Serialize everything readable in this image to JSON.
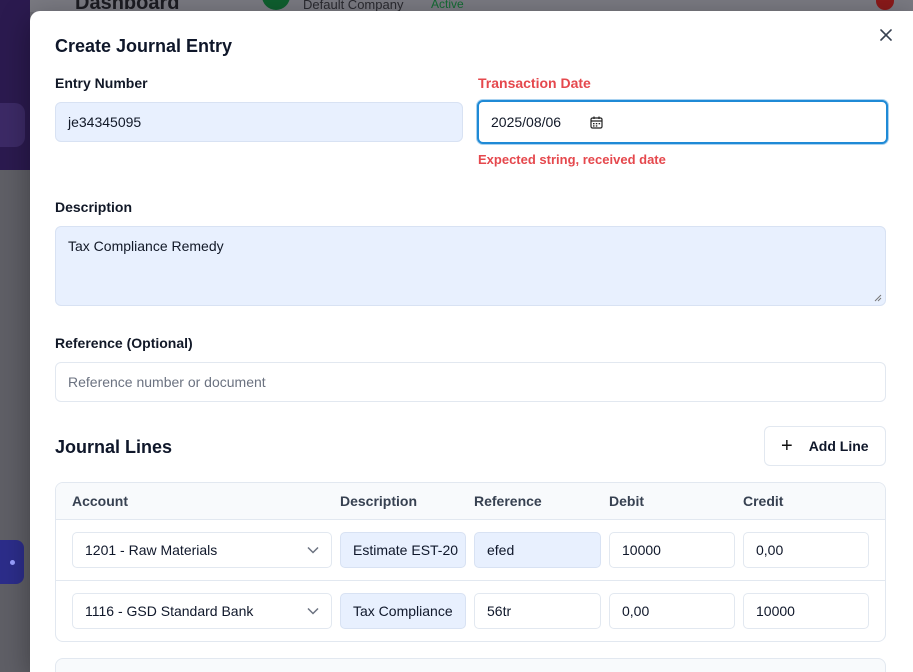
{
  "background": {
    "title": "Dashboard",
    "company": "Default Company",
    "company_status": "Active"
  },
  "modal": {
    "title": "Create Journal Entry",
    "entry_number": {
      "label": "Entry Number",
      "value": "je34345095"
    },
    "transaction_date": {
      "label": "Transaction Date",
      "value": "2025/08/06",
      "error": "Expected string, received date"
    },
    "description": {
      "label": "Description",
      "value": "Tax Compliance Remedy"
    },
    "reference": {
      "label": "Reference (Optional)",
      "placeholder": "Reference number or document"
    },
    "journal_lines": {
      "title": "Journal Lines",
      "add_line_label": "Add Line",
      "columns": [
        "Account",
        "Description",
        "Reference",
        "Debit",
        "Credit"
      ],
      "rows": [
        {
          "account": "1201 - Raw Materials",
          "description": "Estimate EST-20",
          "reference": "efed",
          "debit": "10000",
          "credit": "0,00"
        },
        {
          "account": "1116 - GSD Standard Bank",
          "description": "Tax Compliance",
          "reference": "56tr",
          "debit": "0,00",
          "credit": "10000"
        }
      ]
    }
  },
  "colors": {
    "error": "#e5484d",
    "focus_border": "#1f8ad6",
    "autofill_bg": "#e8f0fe"
  },
  "icons": [
    "close-icon",
    "calendar-icon",
    "plus-icon",
    "chevron-down-icon",
    "resize-grip-icon"
  ]
}
